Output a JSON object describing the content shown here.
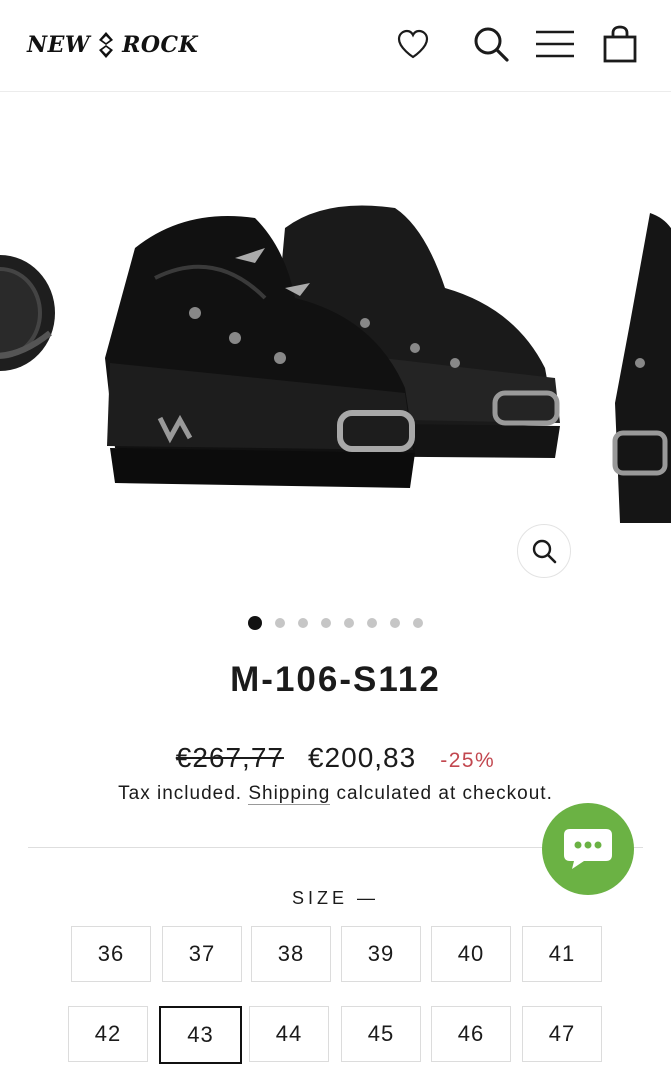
{
  "header": {
    "logo_left": "NEW",
    "logo_right": "ROCK"
  },
  "gallery": {
    "dots_count": 8,
    "active_index": 0
  },
  "product": {
    "title": "M-106-S112",
    "old_price": "€267,77",
    "price": "€200,83",
    "discount": "-25%",
    "tax_prefix": "Tax included. ",
    "tax_link": "Shipping",
    "tax_suffix": " calculated at checkout."
  },
  "size": {
    "label": "SIZE —",
    "options": [
      "36",
      "37",
      "38",
      "39",
      "40",
      "41",
      "42",
      "43",
      "44",
      "45",
      "46",
      "47"
    ],
    "selected": "43"
  },
  "colors": {
    "discount": "#c2474f",
    "chat": "#6bb244"
  }
}
